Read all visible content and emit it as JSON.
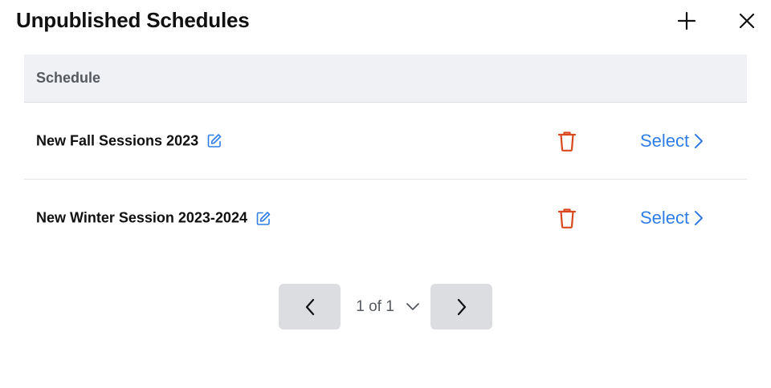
{
  "header": {
    "title": "Unpublished Schedules",
    "add_icon": "plus-icon",
    "close_icon": "close-icon"
  },
  "table": {
    "columns": [
      "Schedule"
    ],
    "rows": [
      {
        "name": "New Fall Sessions 2023",
        "action_label": "Select"
      },
      {
        "name": "New Winter Session 2023-2024",
        "action_label": "Select"
      }
    ]
  },
  "pagination": {
    "page_label": "1 of 1",
    "prev_icon": "chevron-left-icon",
    "next_icon": "chevron-right-icon",
    "dropdown_icon": "chevron-down-icon"
  },
  "colors": {
    "accent": "#2f7ee8",
    "danger": "#d9481e",
    "header_bg": "#f0f1f4",
    "pager_bg": "#dcdde1"
  }
}
